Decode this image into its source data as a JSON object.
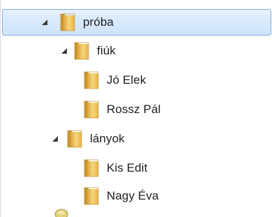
{
  "tree": {
    "nodes": [
      {
        "label": "próba",
        "icon": "folder-icon",
        "expanded": true,
        "selected": true
      },
      {
        "label": "fiúk",
        "icon": "folder-icon",
        "expanded": true
      },
      {
        "label": "Jó Elek",
        "icon": "folder-icon"
      },
      {
        "label": "Rossz Pál",
        "icon": "folder-icon"
      },
      {
        "label": "lányok",
        "icon": "folder-icon",
        "expanded": true
      },
      {
        "label": "Kis Edit",
        "icon": "folder-icon"
      },
      {
        "label": "Nagy Éva",
        "icon": "folder-icon"
      }
    ]
  },
  "colors": {
    "selection_fill": "#d9eafc",
    "selection_border": "#84acdd",
    "folder_yellow": "#f3c75a",
    "expand_arrow": "#3c3c3c"
  }
}
